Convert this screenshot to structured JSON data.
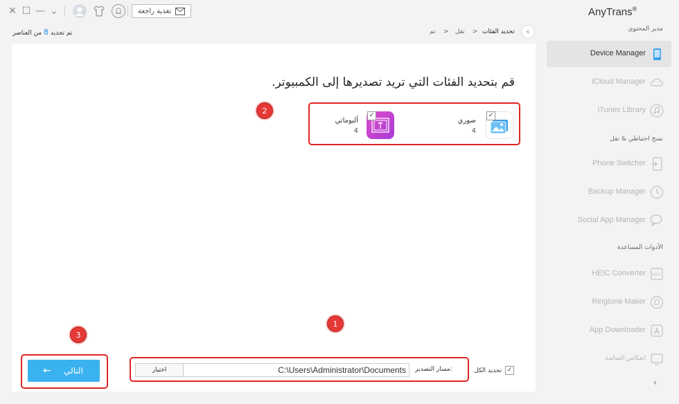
{
  "app": {
    "brand": "AnyTrans",
    "reg": "®"
  },
  "titlebar": {
    "feedback_label": "تغذية راجعة",
    "close": "✕",
    "maximize": "☐",
    "minimize": "—",
    "menu": "⌄"
  },
  "status": {
    "prefix": "تم تحديد ",
    "count": "8",
    "suffix": " من العناصر"
  },
  "breadcrumb": {
    "back": "‹",
    "current": "تحديد الفئات",
    "sep1": ">",
    "mid": "نقل",
    "sep2": ">",
    "first": "تم"
  },
  "main": {
    "heading": "قم بتحديد الفئات التي تريد تصديرها إلى الكمبيوتر."
  },
  "categories": [
    {
      "name": "صوري",
      "count": "4",
      "checked": "✓",
      "icon": "photo-icon",
      "color": "#3aa0e8"
    },
    {
      "name": "ألبوماتي",
      "count": "4",
      "checked": "✓",
      "icon": "album-icon",
      "color": "#c13fd9"
    }
  ],
  "export": {
    "browse_label": "اختيار",
    "path_value": "C:\\Users\\Administrator\\Documents",
    "path_label": "مسار التصدير:",
    "select_all_label": "تحديد الكل",
    "select_all_check": "✓"
  },
  "next_button": {
    "label": "التالي",
    "arrow": "←"
  },
  "badges": [
    "1",
    "2",
    "3"
  ],
  "sidebar": {
    "sections": [
      "مدير المحتوى",
      "نسخ احتياطي & نقل",
      "الأدوات المساعدة"
    ],
    "items": [
      {
        "label": "Device Manager",
        "icon": "phone-icon",
        "active": true
      },
      {
        "label": "iCloud Manager",
        "icon": "cloud-icon"
      },
      {
        "label": "iTunes Library",
        "icon": "music-icon"
      },
      {
        "label": "Phone Switcher",
        "icon": "switch-icon"
      },
      {
        "label": "Backup Manager",
        "icon": "history-icon"
      },
      {
        "label": "Social App Manager",
        "icon": "chat-icon"
      },
      {
        "label": "HEIC Converter",
        "icon": "heic-icon"
      },
      {
        "label": "Ringtone Maker",
        "icon": "bell-icon"
      },
      {
        "label": "App Downloader",
        "icon": "appstore-icon"
      },
      {
        "label": "انعكاس الشاشة",
        "icon": "screen-mirror-icon"
      }
    ],
    "collapse": "‹"
  },
  "colors": {
    "accent": "#3bb2f0",
    "highlight": "#e02424",
    "count": "#2a8de0"
  }
}
